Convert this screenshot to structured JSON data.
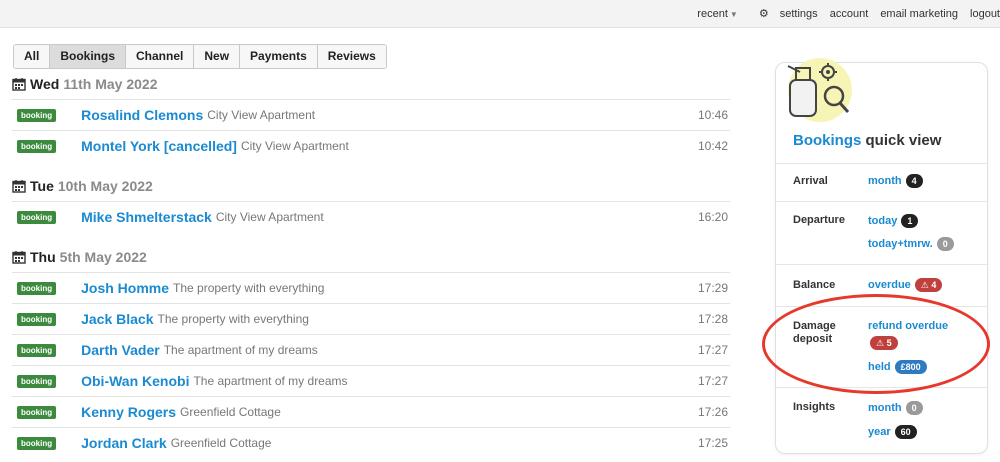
{
  "topnav": {
    "recent": "recent",
    "settings": "settings",
    "account": "account",
    "email_marketing": "email marketing",
    "logout": "logout"
  },
  "tabs": [
    "All",
    "Bookings",
    "Channel",
    "New",
    "Payments",
    "Reviews"
  ],
  "active_tab": "Bookings",
  "days": [
    {
      "weekday": "Wed",
      "date": "11th May 2022",
      "bookings": [
        {
          "badge": "booking",
          "guest": "Rosalind Clemons",
          "property": "City View Apartment",
          "time": "10:46"
        },
        {
          "badge": "booking",
          "guest": "Montel York [cancelled]",
          "property": "City View Apartment",
          "time": "10:42"
        }
      ]
    },
    {
      "weekday": "Tue",
      "date": "10th May 2022",
      "bookings": [
        {
          "badge": "booking",
          "guest": "Mike Shmelterstack",
          "property": "City View Apartment",
          "time": "16:20"
        }
      ]
    },
    {
      "weekday": "Thu",
      "date": "5th May 2022",
      "bookings": [
        {
          "badge": "booking",
          "guest": "Josh Homme",
          "property": "The property with everything",
          "time": "17:29"
        },
        {
          "badge": "booking",
          "guest": "Jack Black",
          "property": "The property with everything",
          "time": "17:28"
        },
        {
          "badge": "booking",
          "guest": "Darth Vader",
          "property": "The apartment of my dreams",
          "time": "17:27"
        },
        {
          "badge": "booking",
          "guest": "Obi-Wan Kenobi",
          "property": "The apartment of my dreams",
          "time": "17:27"
        },
        {
          "badge": "booking",
          "guest": "Kenny Rogers",
          "property": "Greenfield Cottage",
          "time": "17:26"
        },
        {
          "badge": "booking",
          "guest": "Jordan Clark",
          "property": "Greenfield Cottage",
          "time": "17:25"
        }
      ]
    }
  ],
  "quick_view": {
    "title_highlight": "Bookings",
    "title_rest": "quick view",
    "arrival": {
      "label": "Arrival",
      "month_label": "month",
      "month_count": "4"
    },
    "departure": {
      "label": "Departure",
      "today_label": "today",
      "today_count": "1",
      "tmrw_label": "today+tmrw.",
      "tmrw_count": "0"
    },
    "balance": {
      "label": "Balance",
      "overdue_label": "overdue",
      "overdue_count": "4"
    },
    "damage": {
      "label_line1": "Damage",
      "label_line2": "deposit",
      "refund_label": "refund overdue",
      "refund_count": "5",
      "held_label": "held",
      "held_value": "£800"
    },
    "insights": {
      "label": "Insights",
      "month_label": "month",
      "month_count": "0",
      "year_label": "year",
      "year_count": "60"
    }
  },
  "icons": {
    "calendar": "calendar-icon",
    "gear": "gear-icon",
    "chevron": "chevron-down-icon",
    "warning": "warning-icon",
    "logo": "luggage-magnifier-logo"
  },
  "colors": {
    "link": "#1a8ad1",
    "badge_green": "#3c8a3e",
    "warning_red": "#c0403e",
    "held_blue": "#2f7bbf",
    "annotation_red": "#e6392b"
  }
}
